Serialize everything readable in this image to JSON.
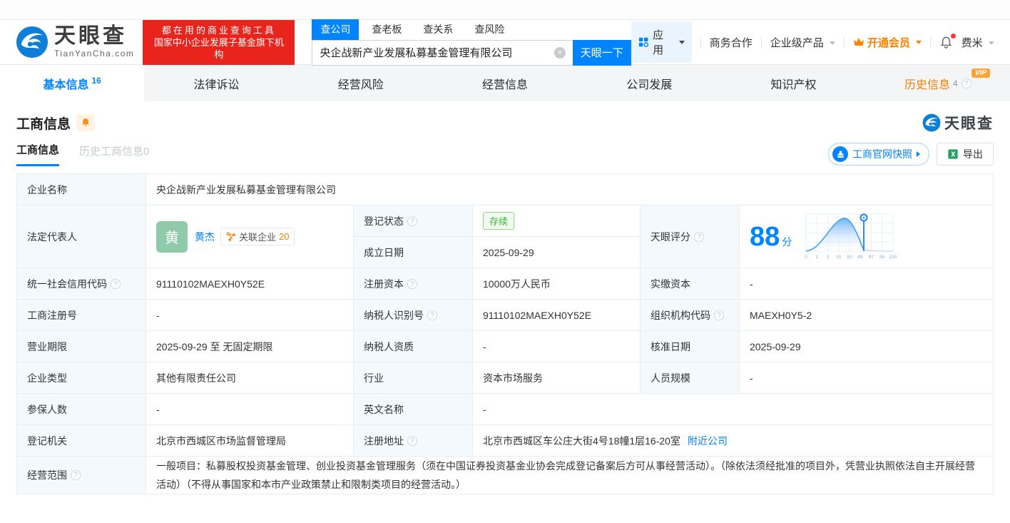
{
  "colors": {
    "primary": "#0084ff",
    "orange": "#ff7d00",
    "green": "#3eb43a",
    "promo_red": "#e8241d"
  },
  "header": {
    "logo": {
      "name": "天眼查",
      "domain": "TianYanCha.com"
    },
    "promo": {
      "line1": "都在用的商业查询工具",
      "line2": "国家中小企业发展子基金旗下机构"
    },
    "search": {
      "tabs": [
        {
          "label": "查公司"
        },
        {
          "label": "查老板"
        },
        {
          "label": "查关系"
        },
        {
          "label": "查风险"
        }
      ],
      "query": "央企战新产业发展私募基金管理有限公司",
      "clear": "×",
      "submit": "天眼一下"
    },
    "menu": {
      "apps": "应用",
      "cooperation": "商务合作",
      "enterprise": "企业级产品",
      "vip": "开通会员",
      "username": "费米"
    }
  },
  "nav": {
    "tabs": [
      {
        "label": "基本信息",
        "count": "16"
      },
      {
        "label": "法律诉讼"
      },
      {
        "label": "经营风险"
      },
      {
        "label": "经营信息"
      },
      {
        "label": "公司发展"
      },
      {
        "label": "知识产权"
      },
      {
        "label": "历史信息",
        "count": "4",
        "badge": "VIP"
      }
    ]
  },
  "section": {
    "title": "工商信息",
    "watermark": "天眼查",
    "subtabs": [
      {
        "label": "工商信息"
      },
      {
        "label": "历史工商信息0"
      }
    ],
    "actions": {
      "snapshot": "工商官网快照",
      "export": "导出"
    }
  },
  "info": {
    "company_name": {
      "label": "企业名称",
      "value": "央企战新产业发展私募基金管理有限公司"
    },
    "legal_rep": {
      "label": "法定代表人",
      "avatar": "黄",
      "name": "黄杰",
      "related_label": "关联企业",
      "related_count": "20"
    },
    "reg_status": {
      "label": "登记状态",
      "value": "存续"
    },
    "establish_date": {
      "label": "成立日期",
      "value": "2025-09-29"
    },
    "score": {
      "label": "天眼评分",
      "value": "88",
      "unit": "分",
      "ticks": [
        "0",
        "1",
        "3",
        "15",
        "50",
        "85",
        "97",
        "99",
        "100"
      ]
    },
    "credit_code": {
      "label": "统一社会信用代码",
      "value": "91110102MAEXH0Y52E"
    },
    "reg_capital": {
      "label": "注册资本",
      "value": "10000万人民币"
    },
    "paid_capital": {
      "label": "实缴资本",
      "value": "-"
    },
    "reg_number": {
      "label": "工商注册号",
      "value": "-"
    },
    "taxpayer_id": {
      "label": "纳税人识别号",
      "value": "91110102MAEXH0Y52E"
    },
    "org_code": {
      "label": "组织机构代码",
      "value": "MAEXH0Y5-2"
    },
    "business_term": {
      "label": "营业期限",
      "value": "2025-09-29 至 无固定期限"
    },
    "taxpayer_quality": {
      "label": "纳税人资质",
      "value": "-"
    },
    "approval_date": {
      "label": "核准日期",
      "value": "2025-09-29"
    },
    "company_type": {
      "label": "企业类型",
      "value": "其他有限责任公司"
    },
    "industry": {
      "label": "行业",
      "value": "资本市场服务"
    },
    "staff_size": {
      "label": "人员规模",
      "value": "-"
    },
    "insured_count": {
      "label": "参保人数",
      "value": "-"
    },
    "english_name": {
      "label": "英文名称",
      "value": "-"
    },
    "reg_authority": {
      "label": "登记机关",
      "value": "北京市西城区市场监督管理局"
    },
    "reg_address": {
      "label": "注册地址",
      "value": "北京市西城区车公庄大街4号18幢1层16-20室",
      "link": "附近公司"
    },
    "business_scope": {
      "label": "经营范围",
      "value": "一般项目：私募股权投资基金管理、创业投资基金管理服务（须在中国证券投资基金业协会完成登记备案后方可从事经营活动）。（除依法须经批准的项目外，凭营业执照依法自主开展经营活动）（不得从事国家和本市产业政策禁止和限制类项目的经营活动。）"
    }
  }
}
